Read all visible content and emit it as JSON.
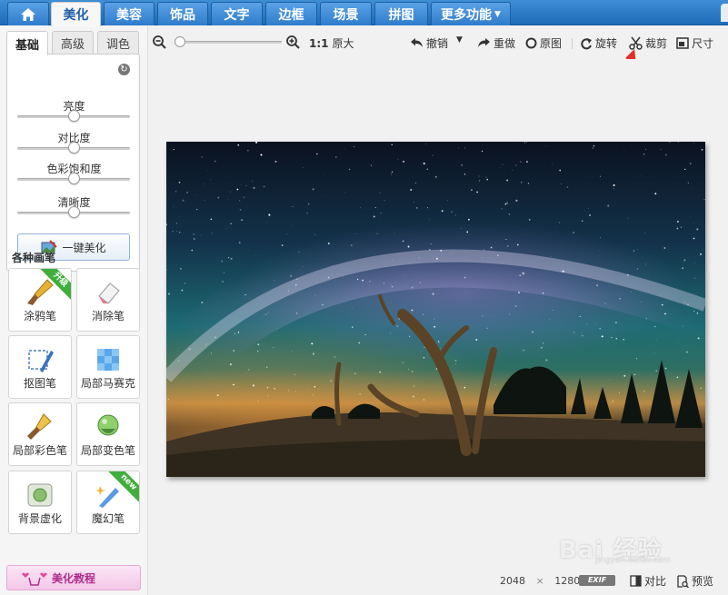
{
  "topnav": {
    "home_icon": "home-icon",
    "tabs": [
      {
        "label": "美化",
        "active": true
      },
      {
        "label": "美容"
      },
      {
        "label": "饰品"
      },
      {
        "label": "文字"
      },
      {
        "label": "边框"
      },
      {
        "label": "场景"
      },
      {
        "label": "拼图"
      },
      {
        "label": "更多功能"
      }
    ]
  },
  "left": {
    "subtabs": [
      "基础",
      "高级",
      "调色"
    ],
    "sliders": [
      {
        "label": "亮度",
        "value": 0.5
      },
      {
        "label": "对比度",
        "value": 0.5
      },
      {
        "label": "色彩饱和度",
        "value": 0.5
      },
      {
        "label": "清晰度",
        "value": 0.5
      }
    ],
    "one_key_label": "一键美化",
    "brush_title": "各种画笔",
    "brushes": [
      {
        "label": "涂鸦笔",
        "badge": "升级"
      },
      {
        "label": "消除笔"
      },
      {
        "label": "抠图笔"
      },
      {
        "label": "局部马赛克"
      },
      {
        "label": "局部彩色笔"
      },
      {
        "label": "局部变色笔"
      },
      {
        "label": "背景虚化"
      },
      {
        "label": "魔幻笔",
        "badge": "new"
      }
    ],
    "tutorial_label": "美化教程"
  },
  "toolbar": {
    "zoom_value": 0.05,
    "one_to_one": "1:1",
    "original_size": "原大",
    "undo": "撤销",
    "redo": "重做",
    "original": "原图",
    "rotate": "旋转",
    "crop": "裁剪",
    "size": "尺寸"
  },
  "status": {
    "width": "2048",
    "times": "×",
    "height": "1280",
    "exif": "EXIF",
    "compare": "对比",
    "preview": "预览"
  },
  "watermark": {
    "text": "Bai 经验",
    "sub": "jingyan.baidu.com"
  },
  "colors": {
    "nav_blue": "#2f7ccb",
    "accent_red": "#e0302a",
    "badge_green": "#3fae3b"
  }
}
